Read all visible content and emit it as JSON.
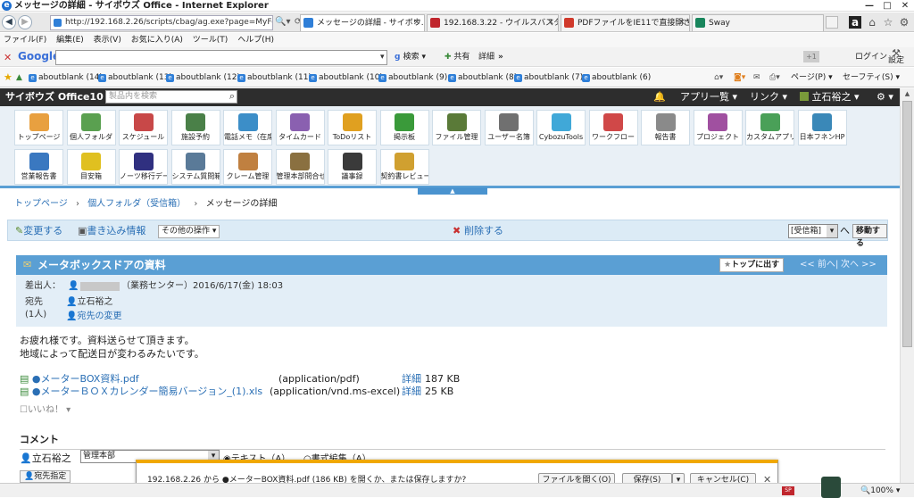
{
  "window": {
    "title": "メッセージの詳細 - サイボウズ Office - Internet Explorer",
    "minimize": "—",
    "maximize": "□",
    "close": "✕"
  },
  "tabs": {
    "address": "http://192.168.2.26/scripts/cbag/ag.exe?page=MyFold",
    "items": [
      {
        "label": "メッセージの詳細 - サイボウ...",
        "active": true
      },
      {
        "label": "192.168.3.22 - ウイルスバスター...",
        "active": false
      },
      {
        "label": "PDFファイルをIE11で直接開きた...",
        "active": false
      },
      {
        "label": "Sway",
        "active": false
      }
    ]
  },
  "menubar": [
    "ファイル(F)",
    "編集(E)",
    "表示(V)",
    "お気に入り(A)",
    "ツール(T)",
    "ヘルプ(H)"
  ],
  "googlebar": {
    "logo": "Google",
    "search_label": "検索",
    "share_label": "共有",
    "detail_label": "詳細",
    "more": "»",
    "login": "ログイン",
    "settings": "設定"
  },
  "favorites": {
    "items": [
      "aboutblank (14)",
      "aboutblank (13)",
      "aboutblank (12)",
      "aboutblank (11)",
      "aboutblank (10)",
      "aboutblank (9)",
      "aboutblank (8)",
      "aboutblank (7)",
      "aboutblank (6)"
    ],
    "page_menu": "ページ(P)",
    "safety_menu": "セーフティ(S)"
  },
  "app": {
    "logo": "サイボウズ Office10",
    "search_placeholder": "製品内を検索",
    "app_list": "アプリ一覧",
    "links": "リンク",
    "user": "立石裕之"
  },
  "apps": [
    {
      "label": "トップページ",
      "color": "#e8a040"
    },
    {
      "label": "個人フォルダ",
      "color": "#5aa050"
    },
    {
      "label": "スケジュール",
      "color": "#c84848"
    },
    {
      "label": "施設予約",
      "color": "#4a8048"
    },
    {
      "label": "電話メモ（在席",
      "color": "#3c8ec8"
    },
    {
      "label": "タイムカード",
      "color": "#8a60b0"
    },
    {
      "label": "ToDoリスト",
      "color": "#e0a020"
    },
    {
      "label": "掲示板",
      "color": "#3a9a3a"
    },
    {
      "label": "ファイル管理",
      "color": "#5a7a38"
    },
    {
      "label": "ユーザー名簿",
      "color": "#707070"
    },
    {
      "label": "CybozuTools",
      "color": "#40a8d8"
    },
    {
      "label": "ワークフロー",
      "color": "#d04848"
    },
    {
      "label": "報告書",
      "color": "#8a8a8a"
    },
    {
      "label": "プロジェクト",
      "color": "#a050a0"
    },
    {
      "label": "カスタムアプリ",
      "color": "#4aa058"
    },
    {
      "label": "日本フネンHP",
      "color": "#3a88b8"
    },
    {
      "label": "営業報告書",
      "color": "#3a78c0"
    },
    {
      "label": "目安箱",
      "color": "#e0c020"
    },
    {
      "label": "ノーツ移行デー",
      "color": "#303080"
    },
    {
      "label": "システム質問箱",
      "color": "#5a7a98"
    },
    {
      "label": "クレーム管理",
      "color": "#c08040"
    },
    {
      "label": "管理本部問合せ",
      "color": "#8a7040"
    },
    {
      "label": "議事録",
      "color": "#3a3a3a"
    },
    {
      "label": "契約書レビュー",
      "color": "#d0a030"
    }
  ],
  "breadcrumb": [
    "トップページ",
    "個人フォルダ（受信箱）",
    "メッセージの詳細"
  ],
  "actions": {
    "edit": "変更する",
    "write": "書き込み情報",
    "other": "その他の操作",
    "delete": "削除する",
    "folder_select": "[受信箱]",
    "move_to": "へ",
    "move_button": "移動する"
  },
  "message": {
    "title": "メータボックスドアの資料",
    "to_top": "トップに出す",
    "prev": "<< 前へ",
    "next": "次へ >>",
    "sender_label": "差出人：",
    "sender_dept": "（業務センター）",
    "date": "2016/6/17(金) 18:03",
    "to_label": "宛先",
    "to_count": "(1人)",
    "recipient": "立石裕之",
    "change_recipient": "宛先の変更",
    "body": [
      "お疲れ様です。資料送らせて頂きます。",
      "地域によって配送日が変わるみたいです。"
    ],
    "attachments": [
      {
        "name": "●メーターBOX資料.pdf",
        "type": "(application/pdf)",
        "detail": "詳細",
        "size": "187 KB"
      },
      {
        "name": "●メーターＢＯＸカレンダー簡易バージョン_(1).xls",
        "type": "(application/vnd.ms-excel)",
        "detail": "詳細",
        "size": "25 KB"
      }
    ],
    "like": "いいね！"
  },
  "comment": {
    "heading": "コメント",
    "author": "立石裕之",
    "dept": "管理本部",
    "text_mode": "テキスト（A）",
    "rich_mode": "書式編集（A）",
    "recipients_btn": "宛先指定"
  },
  "download": {
    "message": "192.168.2.26 から ●メーターBOX資料.pdf (186 KB) を開くか、または保存しますか?",
    "open": "ファイルを開く(O)",
    "save": "保存(S)",
    "cancel": "キャンセル(C)"
  },
  "status": {
    "zoom": "100%"
  }
}
